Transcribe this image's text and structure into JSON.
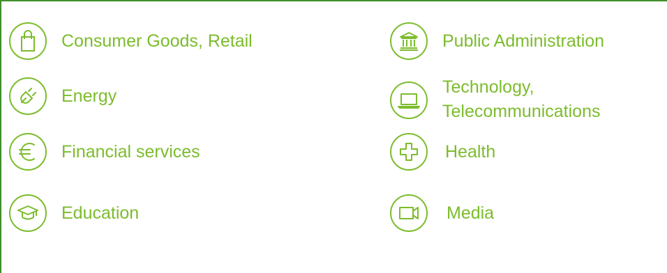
{
  "accent_color": "#7cbc2c",
  "border_color": "#3f8f2a",
  "sectors": [
    {
      "label": "Consumer Goods, Retail",
      "icon": "shopping-bag-icon"
    },
    {
      "label": "Energy",
      "icon": "plug-icon"
    },
    {
      "label": "Financial services",
      "icon": "euro-icon"
    },
    {
      "label": "Education",
      "icon": "graduation-cap-icon"
    },
    {
      "label": "Public Administration",
      "icon": "government-building-icon"
    },
    {
      "label_line1": "Technology,",
      "label_line2": "Telecommunications",
      "icon": "laptop-icon"
    },
    {
      "label": "Health",
      "icon": "medical-cross-icon"
    },
    {
      "label": "Media",
      "icon": "video-camera-icon"
    }
  ]
}
